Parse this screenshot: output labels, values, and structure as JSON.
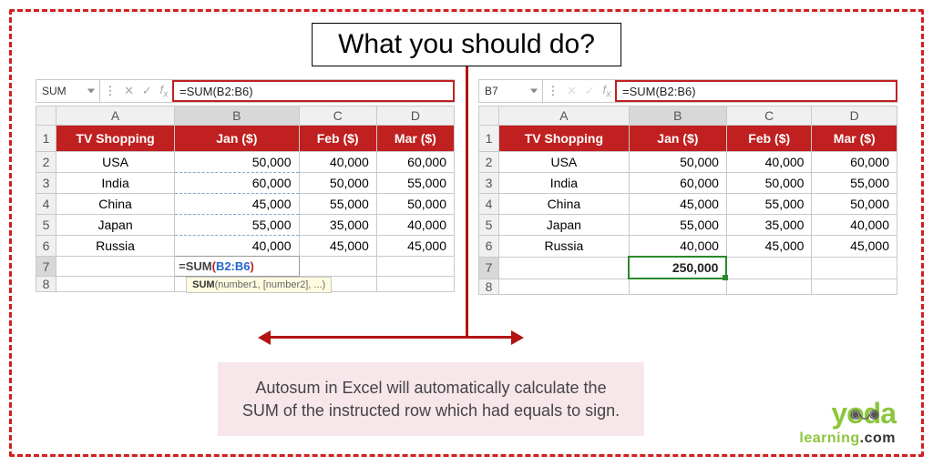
{
  "title": "What you should do?",
  "left": {
    "namebox": "SUM",
    "formula_bar": "=SUM(B2:B6)",
    "columns": [
      "A",
      "B",
      "C",
      "D"
    ],
    "header": [
      "TV Shopping",
      "Jan ($)",
      "Feb ($)",
      "Mar ($)"
    ],
    "rows": [
      {
        "n": "2",
        "label": "USA",
        "b": "50,000",
        "c": "40,000",
        "d": "60,000"
      },
      {
        "n": "3",
        "label": "India",
        "b": "60,000",
        "c": "50,000",
        "d": "55,000"
      },
      {
        "n": "4",
        "label": "China",
        "b": "45,000",
        "c": "55,000",
        "d": "50,000"
      },
      {
        "n": "5",
        "label": "Japan",
        "b": "55,000",
        "c": "35,000",
        "d": "40,000"
      },
      {
        "n": "6",
        "label": "Russia",
        "b": "40,000",
        "c": "45,000",
        "d": "45,000"
      }
    ],
    "formula_display_eq": "=",
    "formula_display_fn": "SUM",
    "formula_display_rng": "B2:B6",
    "tooltip_fn": "SUM",
    "tooltip_args": "(number1, [number2], ...)"
  },
  "right": {
    "namebox": "B7",
    "formula_bar": "=SUM(B2:B6)",
    "columns": [
      "A",
      "B",
      "C",
      "D"
    ],
    "header": [
      "TV Shopping",
      "Jan ($)",
      "Feb ($)",
      "Mar ($)"
    ],
    "rows": [
      {
        "n": "2",
        "label": "USA",
        "b": "50,000",
        "c": "40,000",
        "d": "60,000"
      },
      {
        "n": "3",
        "label": "India",
        "b": "60,000",
        "c": "50,000",
        "d": "55,000"
      },
      {
        "n": "4",
        "label": "China",
        "b": "45,000",
        "c": "55,000",
        "d": "50,000"
      },
      {
        "n": "5",
        "label": "Japan",
        "b": "55,000",
        "c": "35,000",
        "d": "40,000"
      },
      {
        "n": "6",
        "label": "Russia",
        "b": "40,000",
        "c": "45,000",
        "d": "45,000"
      }
    ],
    "result": "250,000"
  },
  "caption": "Autosum in Excel will automatically calculate the SUM of the instructed row which had equals to sign.",
  "logo": {
    "brand_pre": "y",
    "brand_o": "o",
    "brand_da": "da",
    "sub_learning": "learning",
    "sub_com": ".com"
  }
}
